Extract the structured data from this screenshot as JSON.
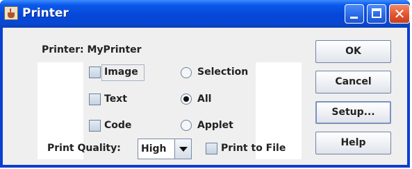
{
  "window": {
    "title": "Printer",
    "title_icon": "java-cup-icon",
    "controls": [
      "minimize-icon",
      "maximize-icon",
      "close-icon"
    ],
    "colors": {
      "titlebar": "#0b59ea",
      "client": "#efefef",
      "close": "#e2552e"
    }
  },
  "printer_label": "Printer: MyPrinter",
  "checkboxes": [
    {
      "label": "Image",
      "checked": false,
      "focused": true
    },
    {
      "label": "Text",
      "checked": false
    },
    {
      "label": "Code",
      "checked": false
    }
  ],
  "radios": [
    {
      "label": "Selection",
      "selected": false
    },
    {
      "label": "All",
      "selected": true
    },
    {
      "label": "Applet",
      "selected": false
    }
  ],
  "quality": {
    "label": "Print Quality:",
    "value": "High"
  },
  "print_to_file": {
    "label": "Print to File",
    "checked": false
  },
  "buttons": {
    "ok": "OK",
    "cancel": "Cancel",
    "setup": "Setup...",
    "help": "Help"
  }
}
